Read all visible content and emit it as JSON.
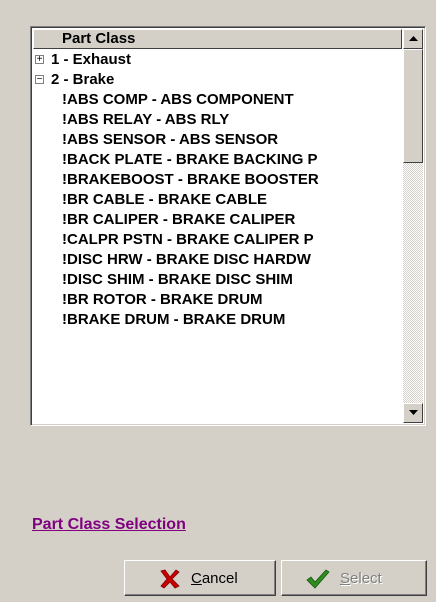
{
  "tree": {
    "header": "Part Class",
    "rows": [
      {
        "label": "1 - Exhaust",
        "expander": "+"
      },
      {
        "label": "2 - Brake",
        "expander": "−"
      },
      {
        "label": "!ABS COMP - ABS COMPONENT"
      },
      {
        "label": "!ABS RELAY - ABS RLY"
      },
      {
        "label": "!ABS SENSOR - ABS SENSOR"
      },
      {
        "label": "!BACK PLATE - BRAKE BACKING P"
      },
      {
        "label": "!BRAKEBOOST - BRAKE BOOSTER"
      },
      {
        "label": "!BR CABLE - BRAKE CABLE"
      },
      {
        "label": "!BR CALIPER - BRAKE CALIPER"
      },
      {
        "label": "!CALPR PSTN - BRAKE CALIPER P"
      },
      {
        "label": "!DISC HRW - BRAKE DISC HARDW"
      },
      {
        "label": "!DISC SHIM - BRAKE DISC SHIM"
      },
      {
        "label": "!BR ROTOR - BRAKE DRUM"
      },
      {
        "label": "!BRAKE DRUM - BRAKE DRUM"
      }
    ]
  },
  "link": {
    "label": "Part Class Selection"
  },
  "buttons": {
    "cancel": {
      "prefix": "",
      "mnemonic": "C",
      "rest": "ancel",
      "icon": "x-mark-icon",
      "icon_color": "#cc0000"
    },
    "select": {
      "prefix": "",
      "mnemonic": "S",
      "rest": "elect",
      "icon": "checkmark-icon",
      "icon_color": "#2e8b1e"
    }
  },
  "colors": {
    "background": "#d4d0c8",
    "link": "#800080"
  }
}
